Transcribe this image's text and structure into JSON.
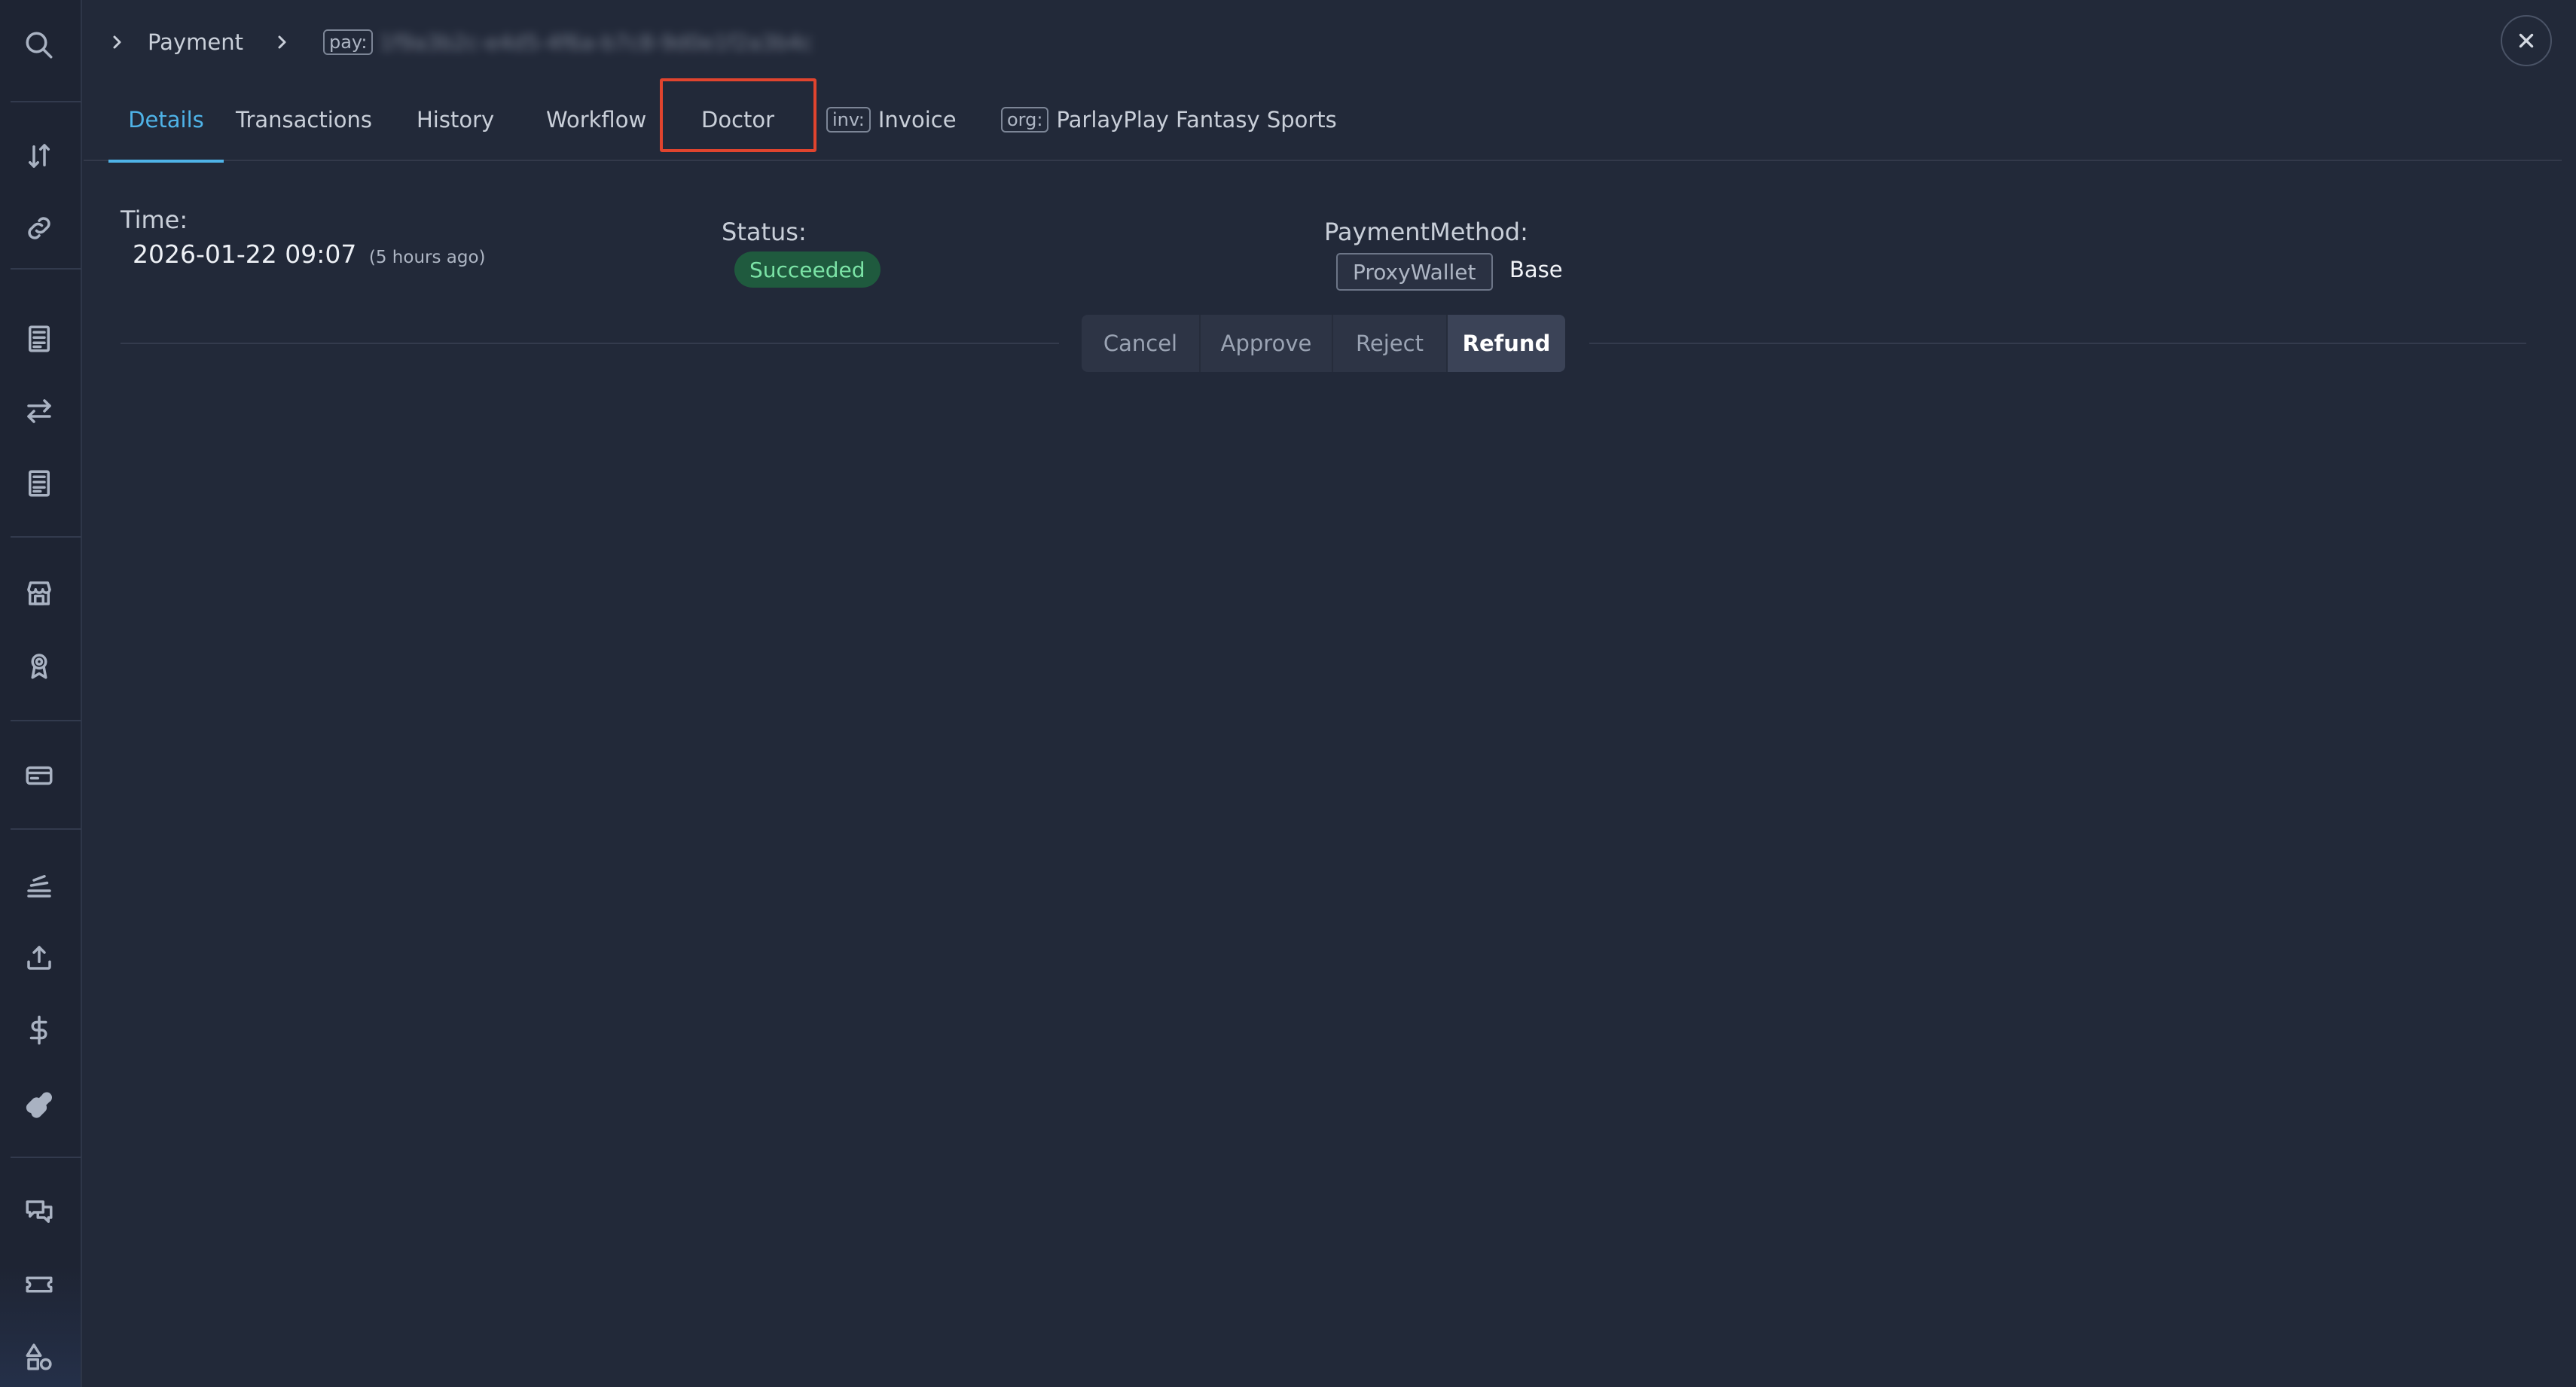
{
  "breadcrumb": {
    "section": "Payment",
    "id_prefix": "pay:",
    "id_value": "1f9a3b2c-e4d5-4f6a-b7c8-9d0e1f2a3b4c"
  },
  "tabs": [
    {
      "label": "Details",
      "active": true
    },
    {
      "label": "Transactions"
    },
    {
      "label": "History"
    },
    {
      "label": "Workflow"
    },
    {
      "label": "Doctor",
      "highlighted": true
    },
    {
      "label": "Invoice",
      "prefix": "inv:"
    },
    {
      "label": "ParlayPlay Fantasy Sports",
      "prefix": "org:"
    }
  ],
  "details": {
    "time_label": "Time:",
    "time_value": "2026-01-22 09:07",
    "time_relative": "(5 hours ago)",
    "status_label": "Status:",
    "status_value": "Succeeded",
    "payment_method_label": "PaymentMethod:",
    "payment_method_type": "ProxyWallet",
    "payment_method_network": "Base"
  },
  "actions": {
    "cancel": "Cancel",
    "approve": "Approve",
    "reject": "Reject",
    "refund": "Refund"
  },
  "sidebar_icons": [
    "search-icon",
    "transfer-icon",
    "link-icon",
    "receipt-icon",
    "exchange-icon",
    "ledger-icon",
    "store-icon",
    "award-icon",
    "card-icon",
    "stack-icon",
    "upload-icon",
    "dollar-icon",
    "puzzle-icon",
    "chat-icon",
    "ticket-icon",
    "shapes-icon"
  ],
  "colors": {
    "background": "#222939",
    "accent": "#4fb3e8",
    "success": "#7be3a6",
    "highlight": "#e0442e"
  }
}
